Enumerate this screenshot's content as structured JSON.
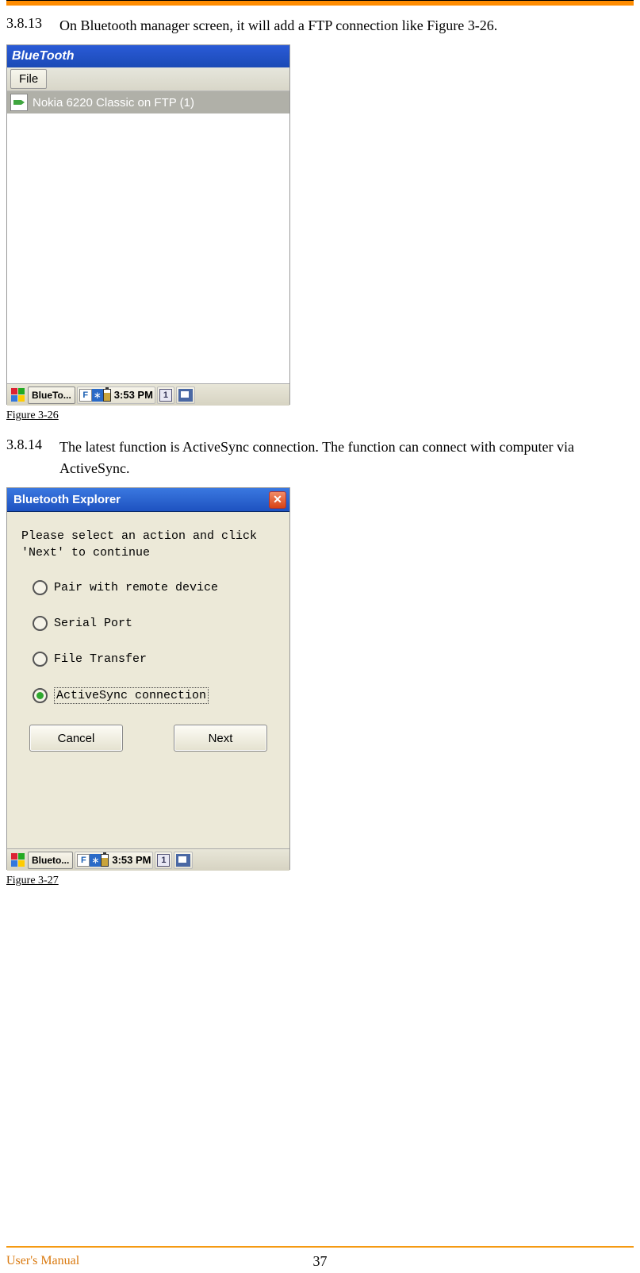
{
  "section1": {
    "num": "3.8.13",
    "text": "On Bluetooth manager screen, it will add a FTP connection like Figure 3-26."
  },
  "shot1": {
    "title": "BlueTooth",
    "menu_file": "File",
    "list_item": "Nokia 6220 Classic on FTP (1)"
  },
  "taskbar": {
    "app": "BlueTo...",
    "time": "3:53 PM",
    "f_label": "F",
    "one_label": "1"
  },
  "fig1_caption": "Figure 3-26",
  "section2": {
    "num": "3.8.14",
    "text": "The latest function is ActiveSync connection. The function can connect with computer via ActiveSync."
  },
  "shot2": {
    "title": "Bluetooth Explorer",
    "prompt": "Please select an action and click 'Next'  to continue",
    "options": {
      "pair": "Pair with remote device",
      "serial": "Serial Port",
      "file": "File Transfer",
      "activesync": "ActiveSync connection"
    },
    "cancel": "Cancel",
    "next": "Next"
  },
  "taskbar2": {
    "app": "Blueto...",
    "time": "3:53 PM"
  },
  "fig2_caption": "Figure 3-27",
  "footer": {
    "label": "User's Manual",
    "page": "37"
  }
}
